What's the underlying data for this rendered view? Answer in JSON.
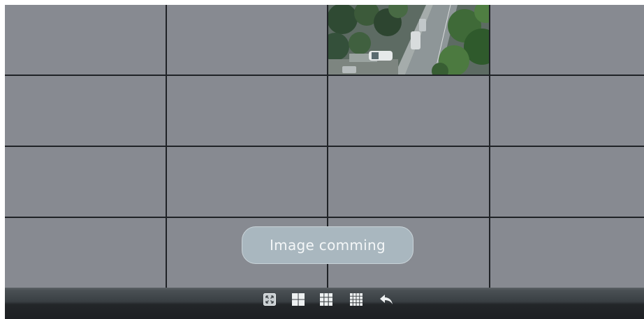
{
  "toast": {
    "message": "Image comming"
  },
  "grid": {
    "layout": "4x4",
    "channels": [
      {
        "state": "empty"
      },
      {
        "state": "empty"
      },
      {
        "state": "live"
      },
      {
        "state": "empty"
      },
      {
        "state": "empty"
      },
      {
        "state": "empty"
      },
      {
        "state": "empty"
      },
      {
        "state": "empty"
      },
      {
        "state": "empty"
      },
      {
        "state": "empty"
      },
      {
        "state": "empty"
      },
      {
        "state": "empty"
      },
      {
        "state": "empty"
      },
      {
        "state": "empty"
      },
      {
        "state": "empty"
      },
      {
        "state": "empty"
      }
    ]
  },
  "toolbar": {
    "buttons": [
      {
        "icon": "fullscreen-icon"
      },
      {
        "icon": "grid-2x2-icon"
      },
      {
        "icon": "grid-3x3-icon"
      },
      {
        "icon": "grid-4x4-icon"
      },
      {
        "icon": "back-arrow-icon"
      }
    ]
  },
  "colors": {
    "empty_tile": "#878a91",
    "grid_line": "#1f2226",
    "toast_bg": "#a9b7bf",
    "toast_text": "#f4f7f8",
    "toolbar_bg": "#1d2023"
  }
}
